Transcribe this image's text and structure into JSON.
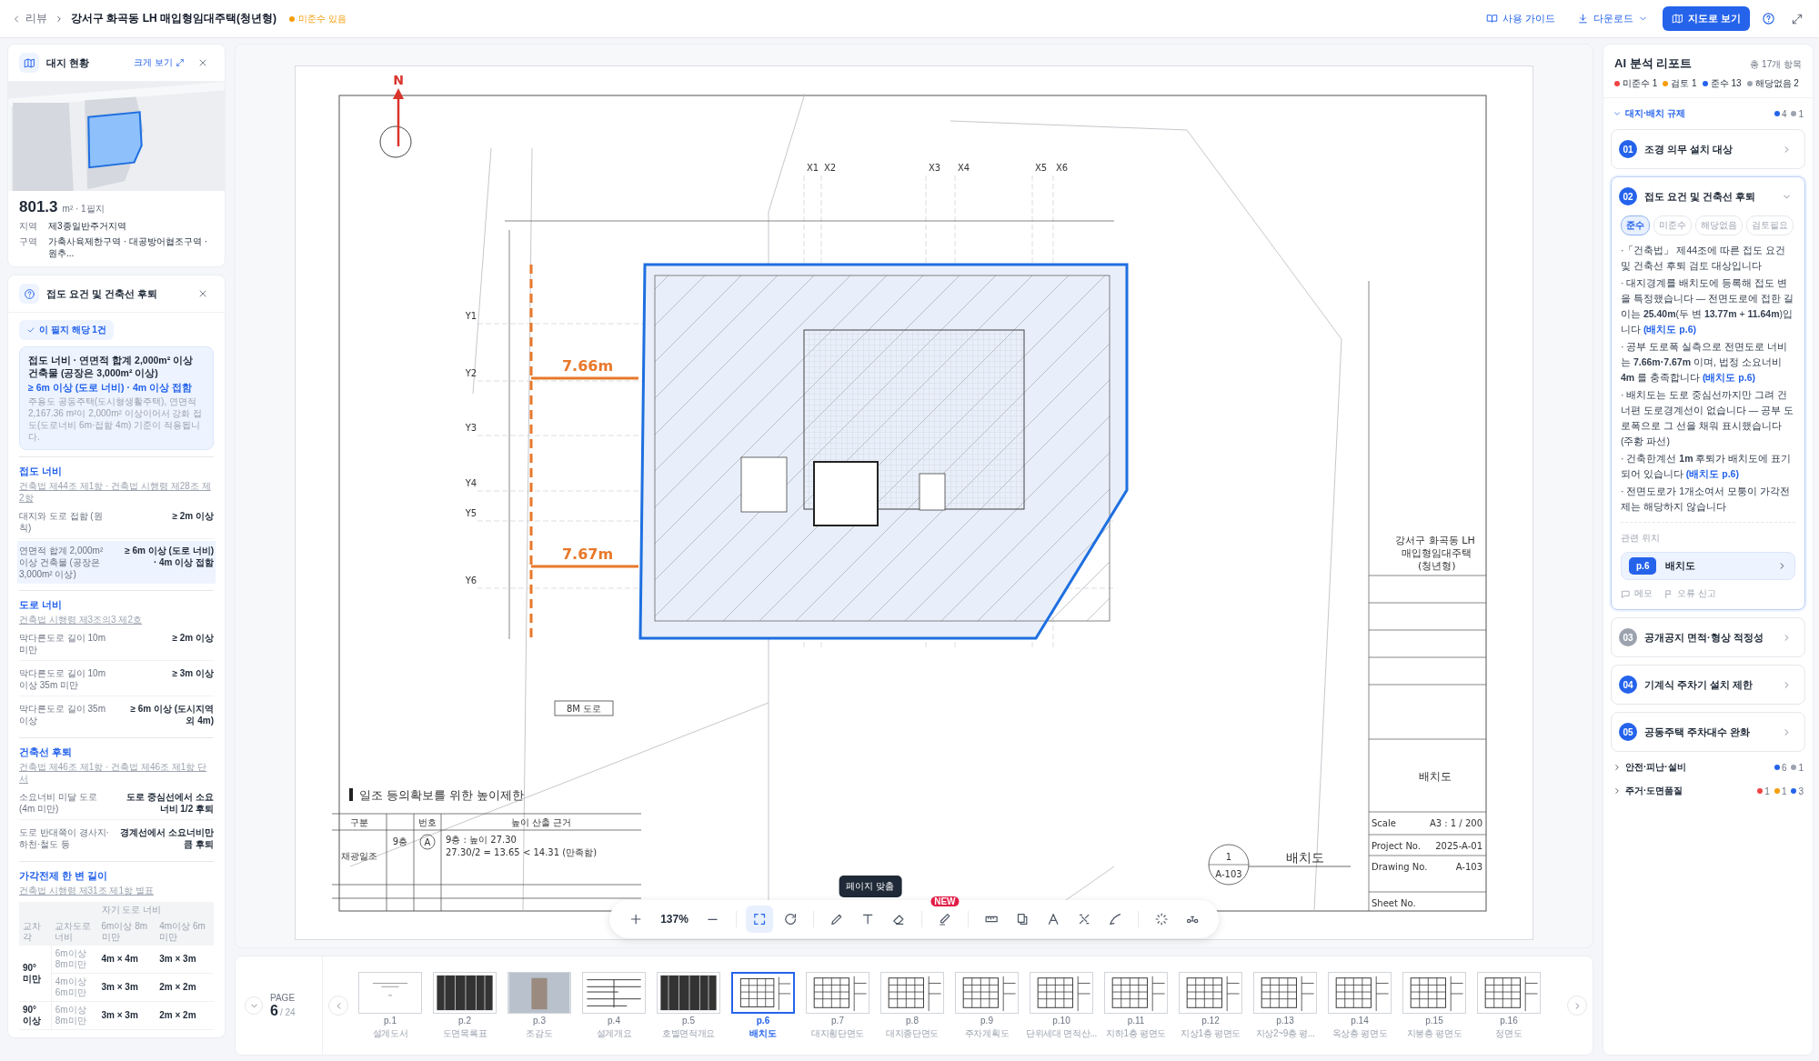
{
  "topbar": {
    "back": "리뷰",
    "title": "강서구 화곡동 LH 매입형임대주택(청년형)",
    "status": {
      "label": "미준수 있음",
      "color": "#f59e0b"
    },
    "actions": [
      {
        "kind": "guide",
        "label": "사용 가이드"
      },
      {
        "kind": "download",
        "label": "다운로드"
      },
      {
        "kind": "map",
        "label": "지도로 보기"
      }
    ]
  },
  "site_card": {
    "title": "대지 현황",
    "expand": "크게 보기",
    "area": "801.3",
    "area_unit": "m² · 1필지",
    "fields": [
      {
        "label": "지역",
        "value": "제3종일반주거지역"
      },
      {
        "label": "구역",
        "value": "가축사육제한구역 · 대공방어협조구역 · 원추..."
      }
    ]
  },
  "rule_card": {
    "title": "접도 요건 및 건축선 후퇴",
    "badge": "이 필지 해당 1건",
    "highlight": {
      "title": "접도 너비 · 연면적 합계 2,000m² 이상 건축물 (공장은 3,000m² 이상)",
      "value": "≥ 6m 이상 (도로 너비) · 4m 이상 접함",
      "note": "주용도 공동주택(도시형생활주택), 연면적 2,167.36 m²이 2,000m² 이상이어서 강화 접도(도로너비 6m·접함 4m) 기준이 적용됩니다."
    },
    "sections": [
      {
        "title": "접도 너비",
        "refs": "건축법 제44조 제1항 · 건축법 시행령 제28조 제2항",
        "rows": [
          {
            "label": "대지와 도로 접함 (원칙)",
            "value": "≥ 2m 이상",
            "selected": false
          },
          {
            "label": "연면적 합계 2,000m² 이상 건축물 (공장은 3,000m² 이상)",
            "value": "≥ 6m 이상 (도로 너비) · 4m 이상 접함",
            "selected": true
          }
        ]
      },
      {
        "title": "도로 너비",
        "refs": "건축법 시행령 제3조의3 제2호",
        "rows": [
          {
            "label": "막다른도로 길이 10m 미만",
            "value": "≥ 2m 이상",
            "selected": false
          },
          {
            "label": "막다른도로 길이 10m 이상 35m 미만",
            "value": "≥ 3m 이상",
            "selected": false
          },
          {
            "label": "막다른도로 길이 35m 이상",
            "value": "≥ 6m 이상 (도시지역 외 4m)",
            "selected": false
          }
        ]
      },
      {
        "title": "건축선 후퇴",
        "refs": "건축법 제46조 제1항 · 건축법 제46조 제1항 단서",
        "rows": [
          {
            "label": "소요너비 미달 도로 (4m 미만)",
            "value": "도로 중심선에서 소요너비 1/2 후퇴",
            "selected": false
          },
          {
            "label": "도로 반대쪽이 경사지·하천·철도 등",
            "value": "경계선에서 소요너비만큼 후퇴",
            "selected": false
          }
        ]
      }
    ],
    "corner_table": {
      "title": "가각전제 한 변 길이",
      "refs": "건축법 시행령 제31조 제1항 별표",
      "group_header": "자기 도로 너비",
      "columns": [
        "교차각",
        "교차도로 너비",
        "6m이상 8m미만",
        "4m이상 6m미만"
      ],
      "groups": [
        {
          "angle": "90° 미만",
          "rows": [
            [
              "6m이상 8m미만",
              "4m × 4m",
              "3m × 3m"
            ],
            [
              "4m이상 6m미만",
              "3m × 3m",
              "2m × 2m"
            ]
          ]
        },
        {
          "angle": "90° 이상",
          "rows": [
            [
              "6m이상 8m미만",
              "3m × 3m",
              "2m × 2m"
            ]
          ]
        }
      ]
    }
  },
  "drawing": {
    "north": "N",
    "dims": [
      {
        "label": "7.66m"
      },
      {
        "label": "7.67m"
      }
    ],
    "grid_x": [
      "X1",
      "X2",
      "X3",
      "X4",
      "X5",
      "X6"
    ],
    "grid_y": [
      "Y1",
      "Y2",
      "Y3",
      "Y4",
      "Y5",
      "Y6"
    ],
    "road": "8M 도로",
    "table": {
      "title": "일조 등의확보를 위한 높이제한",
      "headers": [
        "구분",
        "번호",
        "높이 산출 근거"
      ],
      "row": [
        "채광일조",
        "9층",
        "A",
        "9층 : 높이 27.30",
        "27.30/2 = 13.65 < 14.31 (만족함)"
      ]
    },
    "callout": {
      "number": "1",
      "sheet": "A-103",
      "title": "배치도"
    },
    "title_block": {
      "project": "강서구 화곡동 LH 매입형임대주택 (청년형)",
      "sheet_title": "배치도",
      "fields": [
        {
          "label": "Scale",
          "value": "A3 : 1 / 200"
        },
        {
          "label": "Project No.",
          "value": "2025-A-01"
        },
        {
          "label": "Drawing No.",
          "value": "A-103"
        },
        {
          "label": "Sheet No."
        }
      ]
    }
  },
  "toolbar": {
    "items": [
      {
        "kind": "zoom-in",
        "selected": false
      },
      {
        "kind": "zoom-level",
        "label": "137%"
      },
      {
        "kind": "zoom-out",
        "selected": false
      },
      {
        "kind": "separator"
      },
      {
        "kind": "fit",
        "selected": true,
        "tooltip": "페이지 맞춤"
      },
      {
        "kind": "rotate",
        "selected": false
      },
      {
        "kind": "separator"
      },
      {
        "kind": "pencil",
        "selected": false
      },
      {
        "kind": "text",
        "selected": false
      },
      {
        "kind": "eraser",
        "selected": false
      },
      {
        "kind": "separator"
      },
      {
        "kind": "highlighter",
        "selected": false,
        "badge": "NEW"
      },
      {
        "kind": "separator"
      },
      {
        "kind": "ruler",
        "selected": false
      },
      {
        "kind": "area",
        "selected": false
      },
      {
        "kind": "angle",
        "selected": false
      },
      {
        "kind": "slope",
        "selected": false
      },
      {
        "kind": "curve",
        "selected": false
      },
      {
        "kind": "separator"
      },
      {
        "kind": "sparkle",
        "selected": false
      },
      {
        "kind": "nodes",
        "selected": false
      }
    ]
  },
  "pages": {
    "label": "PAGE",
    "current": "6",
    "total": "/ 24",
    "items": [
      {
        "label": "p.1",
        "title": "설계도서",
        "kind": "cover",
        "selected": false
      },
      {
        "label": "p.2",
        "title": "도면목록표",
        "kind": "table",
        "selected": false
      },
      {
        "label": "p.3",
        "title": "조감도",
        "kind": "photo",
        "selected": false
      },
      {
        "label": "p.4",
        "title": "설계개요",
        "kind": "sheet",
        "selected": false
      },
      {
        "label": "p.5",
        "title": "호별면적개요",
        "kind": "table",
        "selected": false
      },
      {
        "label": "p.6",
        "title": "배치도",
        "kind": "plan",
        "selected": true
      },
      {
        "label": "p.7",
        "title": "대지횡단면도",
        "kind": "plan",
        "selected": false
      },
      {
        "label": "p.8",
        "title": "대지종단면도",
        "kind": "plan",
        "selected": false
      },
      {
        "label": "p.9",
        "title": "주차계획도",
        "kind": "plan",
        "selected": false
      },
      {
        "label": "p.10",
        "title": "단위세대 면적산...",
        "kind": "plan",
        "selected": false
      },
      {
        "label": "p.11",
        "title": "지하1층 평면도",
        "kind": "plan",
        "selected": false
      },
      {
        "label": "p.12",
        "title": "지상1층 평면도",
        "kind": "plan",
        "selected": false
      },
      {
        "label": "p.13",
        "title": "지상2~9층 평...",
        "kind": "plan",
        "selected": false
      },
      {
        "label": "p.14",
        "title": "옥상층 평면도",
        "kind": "plan",
        "selected": false
      },
      {
        "label": "p.15",
        "title": "지붕층 평면도",
        "kind": "plan",
        "selected": false
      },
      {
        "label": "p.16",
        "title": "정면도",
        "kind": "plan",
        "selected": false
      }
    ]
  },
  "report": {
    "title": "AI 분석 리포트",
    "total": "총 17개 항목",
    "legend": [
      {
        "label": "미준수 1",
        "color": "#ef4444"
      },
      {
        "label": "검토 1",
        "color": "#f59e0b"
      },
      {
        "label": "준수 13",
        "color": "#2563eb"
      },
      {
        "label": "해당없음 2",
        "color": "#9ca3af"
      }
    ],
    "groups": [
      {
        "title": "대지·배치 규제",
        "expanded": true,
        "counts": [
          {
            "value": "4",
            "color": "#2563eb"
          },
          {
            "value": "1",
            "color": "#9ca3af"
          }
        ],
        "items": [
          {
            "number": "01",
            "title": "조경 의무 설치 대상",
            "color": "#2563eb",
            "expanded": false
          },
          {
            "number": "02",
            "title": "접도 요건 및 건축선 후퇴",
            "color": "#2563eb",
            "expanded": true,
            "filters": [
              {
                "label": "준수",
                "selected": true
              },
              {
                "label": "미준수",
                "selected": false
              },
              {
                "label": "해당없음",
                "selected": false
              },
              {
                "label": "검토필요",
                "selected": false
              }
            ],
            "bullets": [
              {
                "text": "·「건축법」 제44조에 따른 접도 요건 및 건축선 후퇴 검토 대상입니다"
              },
              {
                "text": "· 대지경계를 배치도에 등록해 접도 변을 특정했습니다 — 전면도로에 접한 길이는 **25.40m**(두 변 **13.77m** + **11.64m**)입니다",
                "link": "(배치도 p.6)"
              },
              {
                "text": "· 공부 도로폭 실측으로 전면도로 너비는 **7.66m·7.67m** 이며, 법정 소요너비 **4m** 를 충족합니다",
                "link": "(배치도 p.6)"
              },
              {
                "text": "· 배치도는 도로 중심선까지만 그려 건너편 도로경계선이 없습니다 — 공부 도로폭으로 그 선을 채워 표시했습니다 (주황 파선)"
              },
              {
                "text": "· 건축한계선 **1m** 후퇴가 배치도에 표기되어 있습니다",
                "link": "(배치도 p.6)"
              },
              {
                "text": "· 전면도로가 1개소여서 모퉁이 가각전제는 해당하지 않습니다"
              }
            ],
            "related_label": "관련 위치",
            "related": {
              "page": "p.6",
              "title": "배치도"
            },
            "actions": [
              {
                "kind": "memo",
                "label": "메모"
              },
              {
                "kind": "report",
                "label": "오류 신고"
              }
            ]
          },
          {
            "number": "03",
            "title": "공개공지 면적·형상 적정성",
            "color": "#9ca3af",
            "expanded": false
          },
          {
            "number": "04",
            "title": "기계식 주차기 설치 제한",
            "color": "#2563eb",
            "expanded": false
          },
          {
            "number": "05",
            "title": "공동주택 주차대수 완화",
            "color": "#2563eb",
            "expanded": false
          }
        ]
      },
      {
        "title": "안전·피난·설비",
        "expanded": false,
        "counts": [
          {
            "value": "6",
            "color": "#2563eb"
          },
          {
            "value": "1",
            "color": "#9ca3af"
          }
        ]
      },
      {
        "title": "주거·도면품질",
        "expanded": false,
        "counts": [
          {
            "value": "1",
            "color": "#ef4444"
          },
          {
            "value": "1",
            "color": "#f59e0b"
          },
          {
            "value": "3",
            "color": "#2563eb"
          }
        ]
      }
    ]
  }
}
